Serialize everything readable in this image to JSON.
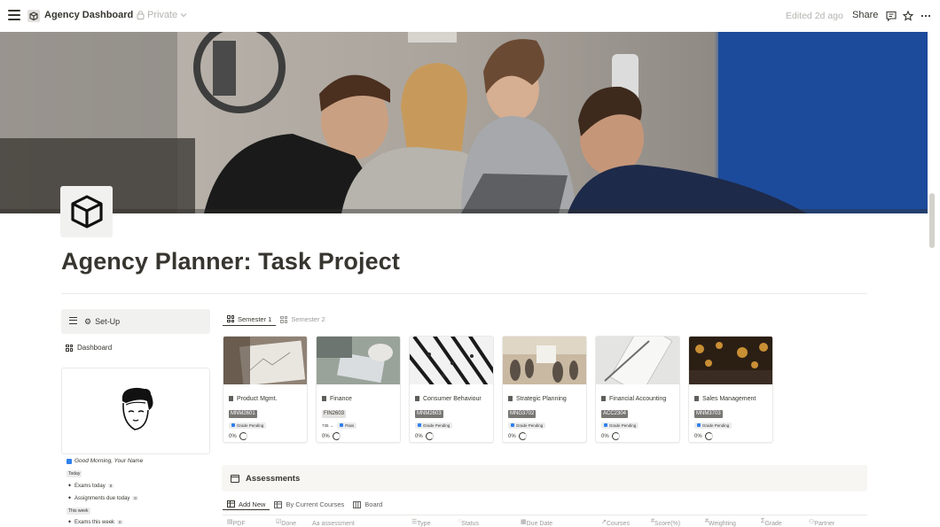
{
  "topbar": {
    "breadcrumb_title": "Agency Dashboard",
    "privacy": "Private",
    "edited": "Edited 2d ago",
    "share_label": "Share"
  },
  "page": {
    "title": "Agency Planner: Task Project"
  },
  "sidebar": {
    "setup_label": "Set-Up",
    "dashboard_label": "Dashboard",
    "greeting": "Good Morning, Your Name",
    "today_chip": "Today",
    "exams_today": "Exams today",
    "exams_today_count": "0",
    "assignments_today": "Assignments due today",
    "assignments_today_count": "0",
    "this_week_chip": "This week",
    "exams_week": "Exams this week",
    "exams_week_count": "0"
  },
  "semester_tabs": [
    {
      "label": "Semester 1",
      "active": true
    },
    {
      "label": "Semester 2",
      "active": false
    }
  ],
  "courses": [
    {
      "title": "Product Mgmt.",
      "code": "MNM2601",
      "status": "Grade Pending",
      "progress": "0%"
    },
    {
      "title": "Finance",
      "code": "FIN2603",
      "status": "Pass",
      "status_prefix": "735 →",
      "progress": "0%"
    },
    {
      "title": "Consumer Behaviour",
      "code": "MNM2603",
      "status": "Grade Pending",
      "progress": "0%"
    },
    {
      "title": "Strategic Planning",
      "code": "MNG3702",
      "status": "Grade Pending",
      "progress": "0%"
    },
    {
      "title": "Financial Accounting",
      "code": "ACC2304",
      "status": "Grade Pending",
      "progress": "0%"
    },
    {
      "title": "Sales Management",
      "code": "MNM3703",
      "status": "Grade Pending",
      "progress": "0%"
    }
  ],
  "assessments": {
    "title": "Assessments",
    "views": [
      {
        "label": "Add New",
        "active": true
      },
      {
        "label": "By Current Courses",
        "active": false
      },
      {
        "label": "Board",
        "active": false
      }
    ],
    "columns": [
      "PDF",
      "Done",
      "Aa  assessment",
      "Type",
      "Status",
      "Due Date",
      "Courses",
      "Score(%)",
      "Weighting",
      "Grade",
      "Partner"
    ]
  },
  "colors": {
    "accent_blue": "#2f80ed",
    "text": "#37352f",
    "muted": "#9b9a97"
  }
}
